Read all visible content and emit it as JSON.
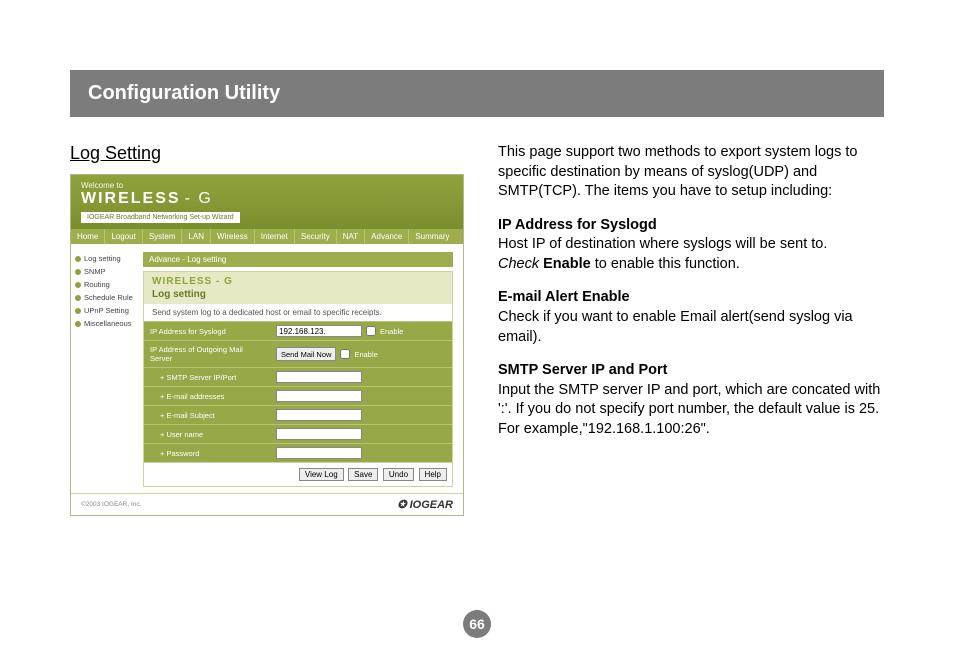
{
  "page_title": "Configuration Utility",
  "section_heading": "Log Setting",
  "page_number": "66",
  "text": {
    "intro": "This page support two methods to export system logs to specific destination by means of syslog(UDP) and SMTP(TCP). The items you have to setup including:",
    "h1": "IP Address for Syslogd",
    "p1a": "Host IP of destination where syslogs will be sent to.",
    "p1b_italic": "Check",
    "p1b_bold": "Enable",
    "p1b_tail": " to enable this function.",
    "h2": "E-mail Alert Enable",
    "p2": "Check if you want to enable Email alert(send syslog via email).",
    "h3": "SMTP Server IP and Port",
    "p3a": "Input the SMTP server IP and port, which are concated with ':'. If you do not specify port number, the default value is 25.",
    "p3b": "For example,\"192.168.1.100:26\"."
  },
  "shot": {
    "welcome": "Welcome to",
    "logo_bold": "WIRELESS",
    "logo_thin": "- G",
    "setup_label": "IOGEAR Broadband Networking Set-up Wizard",
    "tabs": [
      "Home",
      "Logout",
      "System",
      "LAN",
      "Wireless",
      "Internet",
      "Security",
      "NAT",
      "Advance",
      "Summary"
    ],
    "sidebar": [
      "Log setting",
      "SNMP",
      "Routing",
      "Schedule Rule",
      "UPnP Setting",
      "Miscellaneous"
    ],
    "breadcrumb": "Advance - Log setting",
    "panel_logo": "WIRELESS - G",
    "panel_title": "Log setting",
    "panel_sub": "Send system log to a dedicated host or email to specific receipts.",
    "rows": {
      "syslog_label": "IP Address for Syslogd",
      "syslog_value": "192.168.123.",
      "mail_label": "IP Address of Outgoing Mail Server",
      "send_mail_btn": "Send Mail Now",
      "enable": "Enable",
      "smtp_label": "+ SMTP Server IP/Port",
      "emails_label": "+ E-mail addresses",
      "subject_label": "+ E-mail Subject",
      "user_label": "+ User name",
      "pass_label": "+ Password"
    },
    "buttons": {
      "view": "View Log",
      "save": "Save",
      "undo": "Undo",
      "help": "Help"
    },
    "footer_copy": "©2003 IOGEAR, Inc.",
    "footer_brand": "IOGEAR"
  }
}
